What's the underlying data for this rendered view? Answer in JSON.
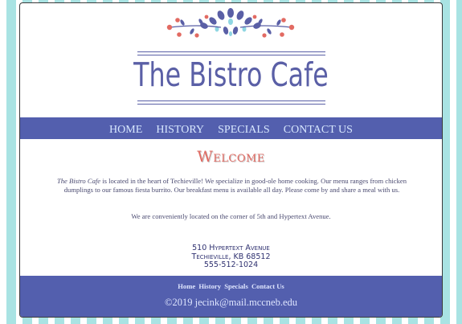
{
  "site": {
    "title": "The Bistro Cafe"
  },
  "nav": {
    "items": [
      "HOME",
      "HISTORY",
      "SPECIALS",
      "CONTACT US"
    ]
  },
  "main": {
    "heading": "Welcome",
    "intro_name": "The Bistro Cafe",
    "intro_text": " is located in the heart of Techieville! We specialize in good-ole home cooking. Our menu ranges from chicken dumplings to our famous fiesta burrito. Our breakfast menu is available all day. Please come by and share a meal with us.",
    "location": "We are conveniently located on the corner of 5th and Hypertext Avenue.",
    "address_line1": "510 Hypertext Avenue",
    "address_line2": "Techieville, KB 68512",
    "phone": "555-512-1024"
  },
  "footer": {
    "links": [
      "Home",
      "History",
      "Specials",
      "Contact Us"
    ],
    "copyright": "©2019 jecink@mail.mccneb.edu"
  },
  "colors": {
    "brand_blue": "#535fae",
    "title_blue": "#5a5fa6",
    "accent_red": "#e26a62",
    "stripe_teal": "#a9e3e3"
  }
}
